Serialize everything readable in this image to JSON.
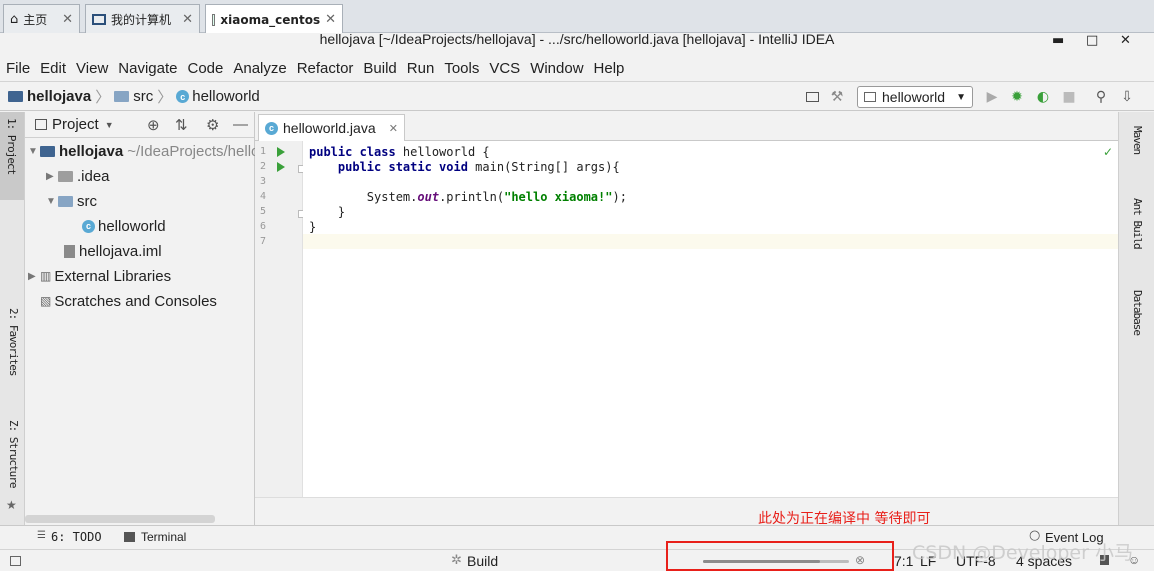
{
  "vm_tabs": [
    {
      "label": "主页"
    },
    {
      "label": "我的计算机"
    },
    {
      "label": "xiaoma_centos"
    }
  ],
  "window": {
    "title": "hellojava [~/IdeaProjects/hellojava] - .../src/helloworld.java [hellojava] - IntelliJ IDEA",
    "minimize": "▬",
    "maximize": "□",
    "close": "✕"
  },
  "menu": [
    "File",
    "Edit",
    "View",
    "Navigate",
    "Code",
    "Analyze",
    "Refactor",
    "Build",
    "Run",
    "Tools",
    "VCS",
    "Window",
    "Help"
  ],
  "breadcrumb": [
    "hellojava",
    "src",
    "helloworld"
  ],
  "run_config": "helloworld",
  "left_stripe": {
    "top": "1: Project",
    "middle": "2: Favorites",
    "bottom": "Z: Structure"
  },
  "right_stripe": [
    "Maven",
    "Ant Build",
    "Database"
  ],
  "project_panel": {
    "title": "Project",
    "tree": [
      {
        "label": "hellojava",
        "path": " ~/IdeaProjects/hellojava"
      },
      {
        "label": ".idea"
      },
      {
        "label": "src"
      },
      {
        "label": "helloworld"
      },
      {
        "label": "hellojava.iml"
      },
      {
        "label": "External Libraries"
      },
      {
        "label": "Scratches and Consoles"
      }
    ]
  },
  "editor": {
    "tab_label": "helloworld.java",
    "line_numbers": [
      "1",
      "2",
      "3",
      "4",
      "5",
      "6",
      "7"
    ],
    "code": {
      "l1_kw": "public class ",
      "l1_rest": "helloworld {",
      "l2_kw": "    public static void ",
      "l2_rest": "main(String[] args){",
      "l4_a": "        System.",
      "l4_field": "out",
      "l4_b": ".println(",
      "l4_str": "\"hello xiaoma!\"",
      "l4_c": ");",
      "l5": "    }",
      "l6": "}"
    }
  },
  "bottom_tools": {
    "todo": "6: TODO",
    "terminal": "Terminal",
    "event_log": "Event Log"
  },
  "status": {
    "build": "Build",
    "position": "7:1",
    "line_sep": "LF",
    "encoding": "UTF-8",
    "indent": "4 spaces",
    "progress": 0.8
  },
  "annotation": "此处为正在编译中 等待即可",
  "watermark": "CSDN @Developer 小马",
  "colors": {
    "accent_red": "#e8201a",
    "run_green": "#3aa03a",
    "folder": "#87a5c4"
  }
}
